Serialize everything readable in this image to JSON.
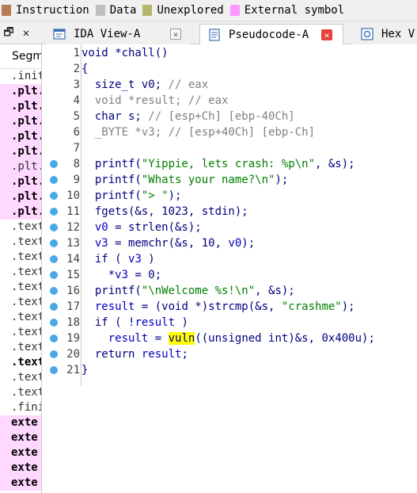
{
  "legend": {
    "items": [
      {
        "label": "Instruction",
        "color": "#b97a57"
      },
      {
        "label": "Data",
        "color": "#c0c0c0"
      },
      {
        "label": "Unexplored",
        "color": "#b5b56a"
      },
      {
        "label": "External symbol",
        "color": "#ff99ff"
      }
    ]
  },
  "corner": {
    "restore": "🗗",
    "close": "✕"
  },
  "tabs": [
    {
      "label": "IDA View-A",
      "icon": "ida-view-icon",
      "active": false
    },
    {
      "label": "Pseudocode-A",
      "icon": "pseudocode-icon",
      "active": true
    },
    {
      "label": "Hex V",
      "icon": "hex-view-icon",
      "active": false
    }
  ],
  "segments": {
    "header": "Segm",
    "rows": [
      {
        "text": ".init",
        "style": ""
      },
      {
        "text": ".plt.",
        "style": "pink bold"
      },
      {
        "text": ".plt.",
        "style": "pink bold"
      },
      {
        "text": ".plt.",
        "style": "pink bold"
      },
      {
        "text": ".plt.",
        "style": "pink bold"
      },
      {
        "text": ".plt.",
        "style": "pink bold"
      },
      {
        "text": ".plt.",
        "style": "pink"
      },
      {
        "text": ".plt.",
        "style": "pink bold"
      },
      {
        "text": ".plt.",
        "style": "pink bold"
      },
      {
        "text": ".plt.",
        "style": "pink bold"
      },
      {
        "text": ".text",
        "style": ""
      },
      {
        "text": ".text",
        "style": ""
      },
      {
        "text": ".text",
        "style": ""
      },
      {
        "text": ".text",
        "style": ""
      },
      {
        "text": ".text",
        "style": ""
      },
      {
        "text": ".text",
        "style": ""
      },
      {
        "text": ".text",
        "style": ""
      },
      {
        "text": ".text",
        "style": ""
      },
      {
        "text": ".text",
        "style": ""
      },
      {
        "text": ".text",
        "style": "bold"
      },
      {
        "text": ".text",
        "style": ""
      },
      {
        "text": ".text",
        "style": ""
      },
      {
        "text": ".fini",
        "style": ""
      },
      {
        "text": "exte",
        "style": "pink bold"
      },
      {
        "text": "exte",
        "style": "pink bold"
      },
      {
        "text": "exte",
        "style": "pink bold"
      },
      {
        "text": "exte",
        "style": "pink bold"
      },
      {
        "text": "exte",
        "style": "pink bold"
      }
    ]
  },
  "code": {
    "lines": [
      {
        "num": "1",
        "bp": false,
        "parts": [
          {
            "t": "void *chall()",
            "c": ""
          }
        ]
      },
      {
        "num": "2",
        "bp": false,
        "parts": [
          {
            "t": "{",
            "c": ""
          }
        ]
      },
      {
        "num": "3",
        "bp": false,
        "parts": [
          {
            "t": "  size_t v0; ",
            "c": ""
          },
          {
            "t": "// eax",
            "c": "gr"
          }
        ]
      },
      {
        "num": "4",
        "bp": false,
        "parts": [
          {
            "t": "  void *result; ",
            "c": "gr"
          },
          {
            "t": "// eax",
            "c": "gr"
          }
        ]
      },
      {
        "num": "5",
        "bp": false,
        "parts": [
          {
            "t": "  char s; ",
            "c": ""
          },
          {
            "t": "// [esp+Ch] [ebp-40Ch]",
            "c": "gr"
          }
        ]
      },
      {
        "num": "6",
        "bp": false,
        "parts": [
          {
            "t": "  _BYTE *v3; ",
            "c": "gr"
          },
          {
            "t": "// [esp+40Ch] [ebp-Ch]",
            "c": "gr"
          }
        ]
      },
      {
        "num": "7",
        "bp": false,
        "parts": [
          {
            "t": "",
            "c": ""
          }
        ]
      },
      {
        "num": "8",
        "bp": true,
        "parts": [
          {
            "t": "  printf(",
            "c": ""
          },
          {
            "t": "\"Yippie, lets crash: %p\\n\"",
            "c": "str"
          },
          {
            "t": ", &s);",
            "c": ""
          }
        ]
      },
      {
        "num": "9",
        "bp": true,
        "parts": [
          {
            "t": "  printf(",
            "c": ""
          },
          {
            "t": "\"Whats your name?\\n\"",
            "c": "str"
          },
          {
            "t": ");",
            "c": ""
          }
        ]
      },
      {
        "num": "10",
        "bp": true,
        "parts": [
          {
            "t": "  printf(",
            "c": ""
          },
          {
            "t": "\"> \"",
            "c": "str"
          },
          {
            "t": ");",
            "c": ""
          }
        ]
      },
      {
        "num": "11",
        "bp": true,
        "parts": [
          {
            "t": "  fgets(&s, 1023, stdin);",
            "c": ""
          }
        ]
      },
      {
        "num": "12",
        "bp": true,
        "parts": [
          {
            "t": "  ",
            "c": ""
          },
          {
            "t": "v0",
            "c": "var"
          },
          {
            "t": " = strlen(&s);",
            "c": ""
          }
        ]
      },
      {
        "num": "13",
        "bp": true,
        "parts": [
          {
            "t": "  ",
            "c": ""
          },
          {
            "t": "v3",
            "c": "var"
          },
          {
            "t": " = memchr(&s, 10, ",
            "c": ""
          },
          {
            "t": "v0",
            "c": "var"
          },
          {
            "t": ");",
            "c": ""
          }
        ]
      },
      {
        "num": "14",
        "bp": true,
        "parts": [
          {
            "t": "  if ( ",
            "c": ""
          },
          {
            "t": "v3",
            "c": "var"
          },
          {
            "t": " )",
            "c": ""
          }
        ]
      },
      {
        "num": "15",
        "bp": true,
        "parts": [
          {
            "t": "    *",
            "c": ""
          },
          {
            "t": "v3",
            "c": "var"
          },
          {
            "t": " = 0;",
            "c": ""
          }
        ]
      },
      {
        "num": "16",
        "bp": true,
        "parts": [
          {
            "t": "  printf(",
            "c": ""
          },
          {
            "t": "\"\\nWelcome %s!\\n\"",
            "c": "str"
          },
          {
            "t": ", &s);",
            "c": ""
          }
        ]
      },
      {
        "num": "17",
        "bp": true,
        "parts": [
          {
            "t": "  ",
            "c": ""
          },
          {
            "t": "result",
            "c": "var"
          },
          {
            "t": " = (void *)strcmp(&s, ",
            "c": ""
          },
          {
            "t": "\"crashme\"",
            "c": "str"
          },
          {
            "t": ");",
            "c": ""
          }
        ]
      },
      {
        "num": "18",
        "bp": true,
        "parts": [
          {
            "t": "  if ( !",
            "c": ""
          },
          {
            "t": "result",
            "c": "var"
          },
          {
            "t": " )",
            "c": ""
          }
        ]
      },
      {
        "num": "19",
        "bp": true,
        "parts": [
          {
            "t": "    ",
            "c": ""
          },
          {
            "t": "result",
            "c": "var"
          },
          {
            "t": " = ",
            "c": ""
          },
          {
            "t": "vuln",
            "c": "hl"
          },
          {
            "t": "((unsigned int)&s, 0x400u);",
            "c": ""
          }
        ]
      },
      {
        "num": "20",
        "bp": true,
        "parts": [
          {
            "t": "  return ",
            "c": ""
          },
          {
            "t": "result",
            "c": "var"
          },
          {
            "t": ";",
            "c": ""
          }
        ]
      },
      {
        "num": "21",
        "bp": true,
        "parts": [
          {
            "t": "}",
            "c": ""
          }
        ]
      }
    ]
  }
}
